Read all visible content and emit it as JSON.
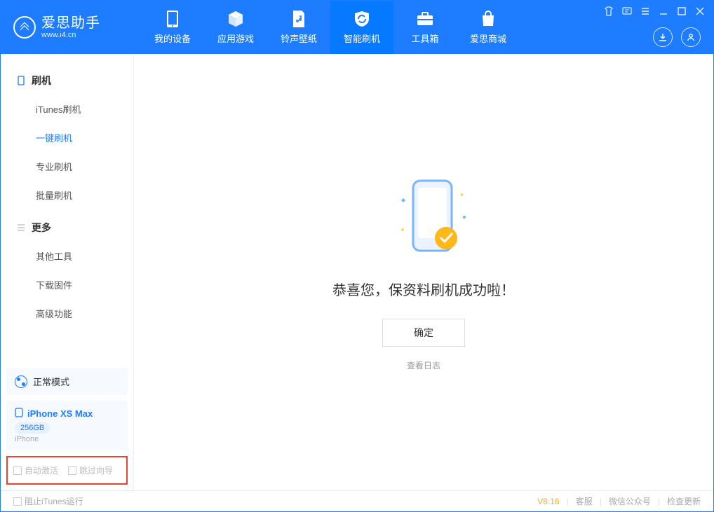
{
  "app": {
    "title": "爱思助手",
    "url": "www.i4.cn"
  },
  "nav": {
    "my_device": "我的设备",
    "apps_games": "应用游戏",
    "ringtone_wallpaper": "铃声壁纸",
    "smart_flash": "智能刷机",
    "toolbox": "工具箱",
    "store": "爱思商城"
  },
  "sidebar": {
    "group_flash": "刷机",
    "sub_itunes": "iTunes刷机",
    "sub_oneclick": "一键刷机",
    "sub_pro": "专业刷机",
    "sub_batch": "批量刷机",
    "group_more": "更多",
    "sub_othertools": "其他工具",
    "sub_download_fw": "下载固件",
    "sub_advanced": "高级功能"
  },
  "mode": {
    "label": "正常模式"
  },
  "device": {
    "name": "iPhone XS Max",
    "storage": "256GB",
    "type": "iPhone"
  },
  "checks": {
    "auto_activate": "自动激活",
    "skip_guide": "跳过向导"
  },
  "main": {
    "success": "恭喜您，保资料刷机成功啦！",
    "ok": "确定",
    "view_log": "查看日志"
  },
  "footer": {
    "block_itunes": "阻止iTunes运行",
    "version": "V8.16",
    "service": "客服",
    "wechat": "微信公众号",
    "check_update": "检查更新"
  }
}
